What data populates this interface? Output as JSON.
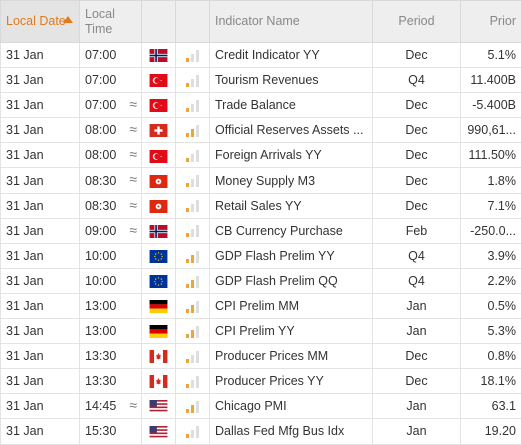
{
  "headers": {
    "date": "Local Date",
    "time": "Local Time",
    "indicator": "Indicator Name",
    "period": "Period",
    "prior": "Prior"
  },
  "colors": {
    "accent": "#e07a1b",
    "importance_on": "#f0a23c",
    "importance_off": "#dedede"
  },
  "rows": [
    {
      "date": "31 Jan",
      "time": "07:00",
      "approx": "",
      "country": "norway",
      "importance": 1,
      "name": "Credit Indicator YY",
      "period": "Dec",
      "prior": "5.1%"
    },
    {
      "date": "31 Jan",
      "time": "07:00",
      "approx": "",
      "country": "turkey",
      "importance": 1,
      "name": "Tourism Revenues",
      "period": "Q4",
      "prior": "11.400B"
    },
    {
      "date": "31 Jan",
      "time": "07:00",
      "approx": "≈",
      "country": "turkey",
      "importance": 1,
      "name": "Trade Balance",
      "period": "Dec",
      "prior": "-5.400B"
    },
    {
      "date": "31 Jan",
      "time": "08:00",
      "approx": "≈",
      "country": "switzerland",
      "importance": 2,
      "name": "Official Reserves Assets ...",
      "period": "Dec",
      "prior": "990,61..."
    },
    {
      "date": "31 Jan",
      "time": "08:00",
      "approx": "≈",
      "country": "turkey",
      "importance": 1,
      "name": "Foreign Arrivals YY",
      "period": "Dec",
      "prior": "111.50%"
    },
    {
      "date": "31 Jan",
      "time": "08:30",
      "approx": "≈",
      "country": "hongkong",
      "importance": 1,
      "name": "Money Supply M3",
      "period": "Dec",
      "prior": "1.8%"
    },
    {
      "date": "31 Jan",
      "time": "08:30",
      "approx": "≈",
      "country": "hongkong",
      "importance": 1,
      "name": "Retail Sales YY",
      "period": "Dec",
      "prior": "7.1%"
    },
    {
      "date": "31 Jan",
      "time": "09:00",
      "approx": "≈",
      "country": "norway",
      "importance": 1,
      "name": "CB Currency Purchase",
      "period": "Feb",
      "prior": "-250.0..."
    },
    {
      "date": "31 Jan",
      "time": "10:00",
      "approx": "",
      "country": "eu",
      "importance": 2,
      "name": "GDP Flash Prelim YY",
      "period": "Q4",
      "prior": "3.9%"
    },
    {
      "date": "31 Jan",
      "time": "10:00",
      "approx": "",
      "country": "eu",
      "importance": 2,
      "name": "GDP Flash Prelim QQ",
      "period": "Q4",
      "prior": "2.2%"
    },
    {
      "date": "31 Jan",
      "time": "13:00",
      "approx": "",
      "country": "germany",
      "importance": 2,
      "name": "CPI Prelim MM",
      "period": "Jan",
      "prior": "0.5%"
    },
    {
      "date": "31 Jan",
      "time": "13:00",
      "approx": "",
      "country": "germany",
      "importance": 2,
      "name": "CPI Prelim YY",
      "period": "Jan",
      "prior": "5.3%"
    },
    {
      "date": "31 Jan",
      "time": "13:30",
      "approx": "",
      "country": "canada",
      "importance": 1,
      "name": "Producer Prices MM",
      "period": "Dec",
      "prior": "0.8%"
    },
    {
      "date": "31 Jan",
      "time": "13:30",
      "approx": "",
      "country": "canada",
      "importance": 1,
      "name": "Producer Prices YY",
      "period": "Dec",
      "prior": "18.1%"
    },
    {
      "date": "31 Jan",
      "time": "14:45",
      "approx": "≈",
      "country": "usa",
      "importance": 2,
      "name": "Chicago PMI",
      "period": "Jan",
      "prior": "63.1"
    },
    {
      "date": "31 Jan",
      "time": "15:30",
      "approx": "",
      "country": "usa",
      "importance": 1,
      "name": "Dallas Fed Mfg Bus Idx",
      "period": "Jan",
      "prior": "19.20"
    }
  ]
}
